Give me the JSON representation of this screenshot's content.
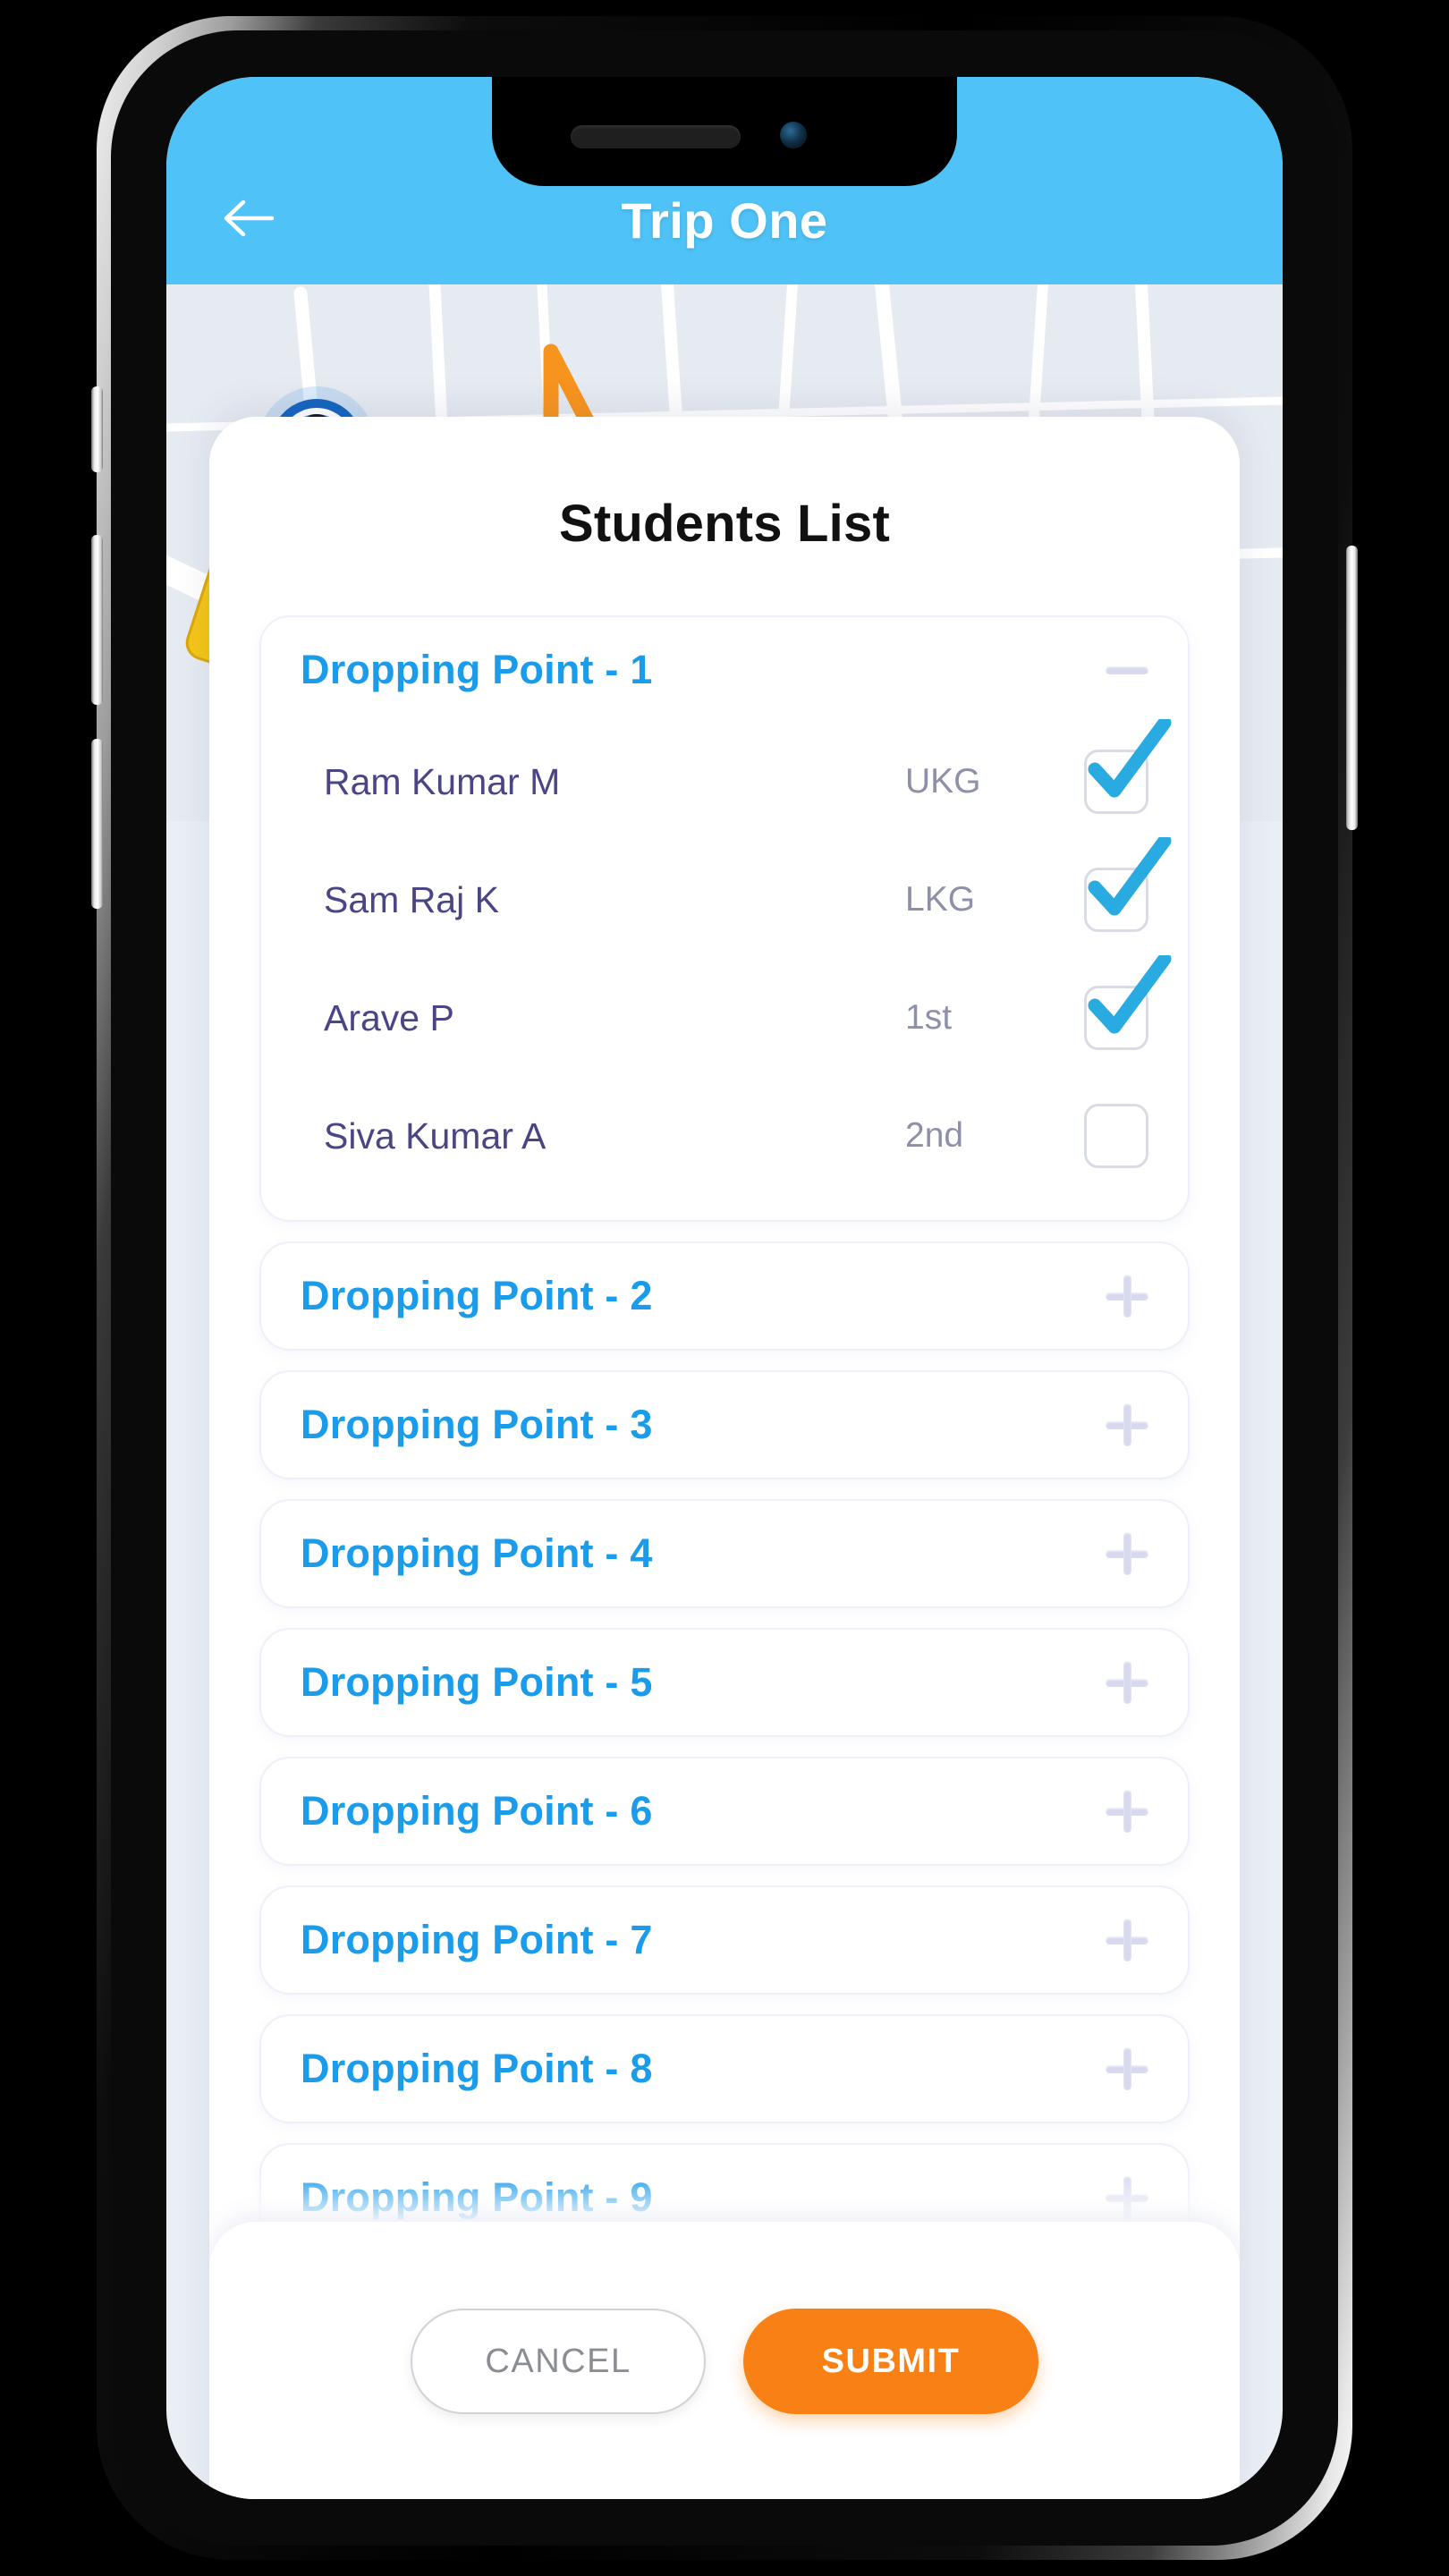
{
  "header": {
    "title": "Trip One",
    "back_icon": "arrow-left-icon",
    "background_color": "#4FC3F7"
  },
  "map": {
    "background_color": "#e6eaf1",
    "route_color": "#F7941D",
    "road_color": "#ffffff",
    "stop_marker_color": "#E8181C",
    "bus_color": "#F5C518",
    "driver_marker_color": "#1E88E5"
  },
  "sheet": {
    "title": "Students List"
  },
  "dropping_points": [
    {
      "label": "Dropping Point - 1",
      "expanded": true,
      "toggle_icon": "minus-icon",
      "students": [
        {
          "name": "Ram Kumar M",
          "grade": "UKG",
          "checked": true
        },
        {
          "name": "Sam Raj K",
          "grade": "LKG",
          "checked": true
        },
        {
          "name": "Arave P",
          "grade": "1st",
          "checked": true
        },
        {
          "name": "Siva Kumar A",
          "grade": "2nd",
          "checked": false
        }
      ]
    },
    {
      "label": "Dropping Point - 2",
      "expanded": false,
      "toggle_icon": "plus-icon",
      "students": []
    },
    {
      "label": "Dropping Point - 3",
      "expanded": false,
      "toggle_icon": "plus-icon",
      "students": []
    },
    {
      "label": "Dropping Point - 4",
      "expanded": false,
      "toggle_icon": "plus-icon",
      "students": []
    },
    {
      "label": "Dropping Point - 5",
      "expanded": false,
      "toggle_icon": "plus-icon",
      "students": []
    },
    {
      "label": "Dropping Point - 6",
      "expanded": false,
      "toggle_icon": "plus-icon",
      "students": []
    },
    {
      "label": "Dropping Point - 7",
      "expanded": false,
      "toggle_icon": "plus-icon",
      "students": []
    },
    {
      "label": "Dropping Point - 8",
      "expanded": false,
      "toggle_icon": "plus-icon",
      "students": []
    },
    {
      "label": "Dropping Point - 9",
      "expanded": false,
      "toggle_icon": "plus-icon",
      "students": []
    }
  ],
  "footer": {
    "cancel_label": "CANCEL",
    "submit_label": "SUBMIT",
    "submit_color": "#F98014"
  },
  "theme": {
    "accent_blue": "#1B9CEA",
    "header_blue": "#4FC3F7",
    "name_color": "#4a4585",
    "grade_color": "#8d90a8",
    "icon_color": "#d7daee"
  }
}
